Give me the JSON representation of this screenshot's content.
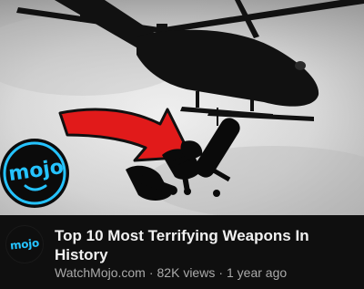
{
  "video": {
    "title": "Top 10 Most Terrifying Weapons In History",
    "channel": "WatchMojo.com",
    "views": "82K views",
    "age": "1 year ago",
    "separator": "·"
  },
  "thumbnail": {
    "badge_text": "mojo",
    "badge_color": "#25c3ff",
    "arrow_color": "#e11a1a",
    "icons": [
      "helicopter-silhouette",
      "red-arrow",
      "falling-figure-silhouette"
    ]
  },
  "avatar": {
    "text": "mojo"
  }
}
